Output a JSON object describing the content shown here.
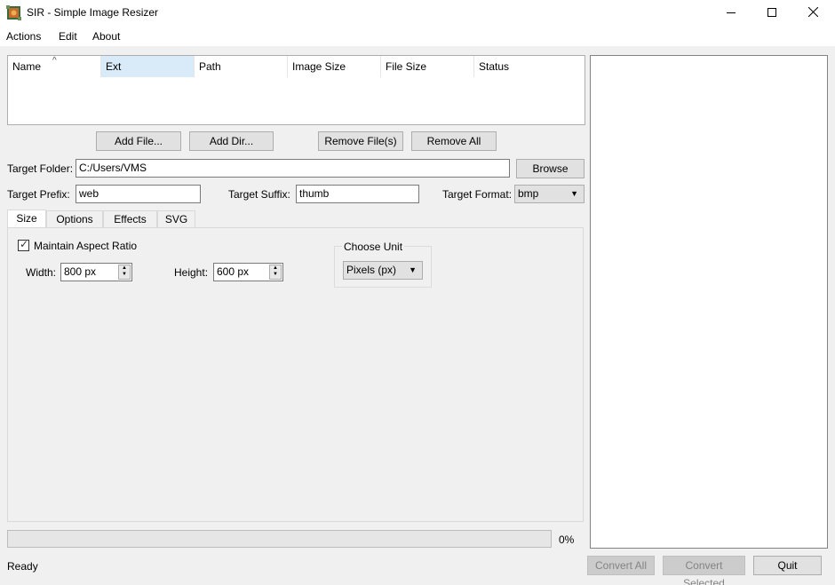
{
  "window": {
    "title": "SIR - Simple Image Resizer",
    "app_icon": "sir-app-icon",
    "controls": {
      "minimize": "minimize-icon",
      "maximize": "maximize-icon",
      "close": "close-icon"
    }
  },
  "menu": {
    "items": [
      {
        "label": "Actions"
      },
      {
        "label": "Edit"
      },
      {
        "label": "About"
      }
    ]
  },
  "file_table": {
    "columns": [
      {
        "label": "Name"
      },
      {
        "label": "Ext"
      },
      {
        "label": "Path"
      },
      {
        "label": "Image Size"
      },
      {
        "label": "File Size"
      },
      {
        "label": "Status"
      }
    ],
    "selected_column": "Ext",
    "sort_indicator": "^",
    "rows": []
  },
  "file_buttons": {
    "add_file": "Add File...",
    "add_dir": "Add Dir...",
    "remove_files": "Remove File(s)",
    "remove_all": "Remove All"
  },
  "target": {
    "folder_label": "Target Folder:",
    "folder_value": "C:/Users/VMS",
    "browse": "Browse",
    "prefix_label": "Target Prefix:",
    "prefix_value": "web",
    "suffix_label": "Target Suffix:",
    "suffix_value": "thumb",
    "format_label": "Target Format:",
    "format_value": "bmp"
  },
  "tabs": [
    {
      "label": "Size",
      "active": true
    },
    {
      "label": "Options",
      "active": false
    },
    {
      "label": "Effects",
      "active": false
    },
    {
      "label": "SVG",
      "active": false
    }
  ],
  "size_tab": {
    "maintain_aspect_label": "Maintain Aspect Ratio",
    "maintain_aspect_checked": true,
    "check_mark": "✓",
    "width_label": "Width:",
    "width_value": "800 px",
    "height_label": "Height:",
    "height_value": "600 px",
    "unit_group_title": "Choose Unit",
    "unit_value": "Pixels (px)"
  },
  "progress": {
    "percent": 0,
    "text": "0%"
  },
  "actions": {
    "convert_all": "Convert All",
    "convert_selected": "Convert Selected",
    "quit": "Quit"
  },
  "status_bar": {
    "text": "Ready"
  }
}
